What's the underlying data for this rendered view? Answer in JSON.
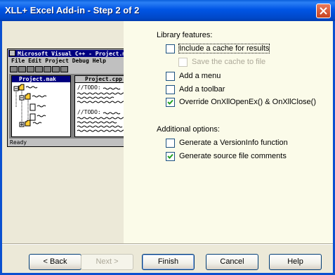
{
  "window": {
    "title": "XLL+ Excel Add-in - Step 2 of 2"
  },
  "illustration": {
    "app_title": "Microsoft Visual C++ - Project.mak",
    "menu": [
      "File",
      "Edit",
      "Project",
      "Debug",
      "Help"
    ],
    "project_pane_title": "Project.mak",
    "source_pane_title": "Project.cpp",
    "todo_text": "//TODO:",
    "status_text": "Ready"
  },
  "library": {
    "heading": "Library features:",
    "options": [
      {
        "label": "Include a cache for results",
        "checked": false,
        "enabled": true
      },
      {
        "label": "Save the cache to file",
        "checked": false,
        "enabled": false
      },
      {
        "label": "Add a menu",
        "checked": false,
        "enabled": true
      },
      {
        "label": "Add a toolbar",
        "checked": false,
        "enabled": true
      },
      {
        "label": "Override OnXllOpenEx() & OnXllClose()",
        "checked": true,
        "enabled": true
      }
    ]
  },
  "additional": {
    "heading": "Additional options:",
    "options": [
      {
        "label": "Generate a VersionInfo function",
        "checked": false,
        "enabled": true
      },
      {
        "label": "Generate source file comments",
        "checked": true,
        "enabled": true
      }
    ]
  },
  "buttons": {
    "back": "< Back",
    "next": "Next >",
    "finish": "Finish",
    "cancel": "Cancel",
    "help": "Help"
  }
}
